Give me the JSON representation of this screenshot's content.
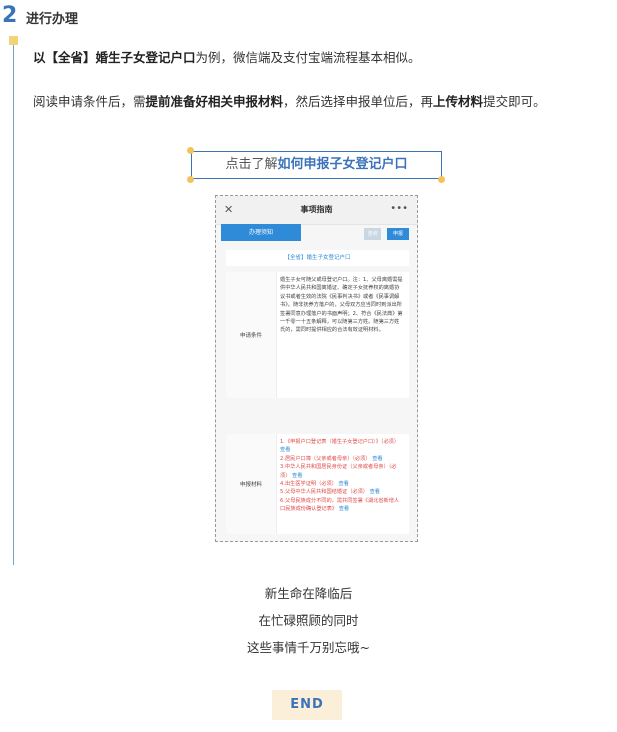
{
  "header": {
    "step_number": "2",
    "title": "进行办理"
  },
  "intro": {
    "p1_bold": "以【全省】婚生子女登记户口",
    "p1_rest": "为例，微信端及支付宝端流程基本相似。",
    "p2_a": "阅读申请条件后，需",
    "p2_b": "提前准备好相关申报材料",
    "p2_c": "，然后选择申报单位后，再",
    "p2_d": "上传材料",
    "p2_e": "提交即可。"
  },
  "link": {
    "prefix": "点击了解",
    "bold": "如何申报子女登记户口"
  },
  "screenshot": {
    "title": "事项指南",
    "close": "✕",
    "more": "•••",
    "tab": "办理须知",
    "btn_consult": "咨询",
    "btn_apply": "申报",
    "subtitle": "【全省】婚生子女登记户口",
    "cond_label": "申请条件",
    "cond_text": "婚生子女可随父或母登记户口。注：1、父母离婚需提供中华人民共和国离婚证、确定子女抚养权的离婚协议书或者生效的法院《民事判决书》或者《民事调解书》。随非抚养方落户的，父母双方应当同时到派出所签署同意办理落户的书面声明；2、符合《民法典》第一千零一十五条解释，可以随第三方姓。随第三方姓氏的，需同时提供相应的合法有效证明材料。",
    "mat_label": "申报材料",
    "materials": [
      {
        "text": "1.《申报户口登记表（婚生子女登记户口）》（必须）",
        "link": "查看"
      },
      {
        "text": "2.居民户口簿（父亲或者母亲）（必须）",
        "link": "查看"
      },
      {
        "text": "3.中华人民共和国居民身份证（父亲或者母亲）（必须）",
        "link": "查看"
      },
      {
        "text": "4.出生医学证明（必须）",
        "link": "查看"
      },
      {
        "text": "5.父母中华人民共和国结婚证（必须）",
        "link": "查看"
      },
      {
        "text": "6.父母民族成分不同的，需共同签署《湖北省新增人口民族成份确认登记表》",
        "link": "查看"
      }
    ]
  },
  "closing": [
    "新生命在降临后",
    "在忙碌照顾的同时",
    "这些事情千万别忘哦~"
  ],
  "end": "END",
  "colors": {
    "accent": "#3b73b9",
    "highlight": "#f3d37a",
    "red": "#e04a4a"
  }
}
